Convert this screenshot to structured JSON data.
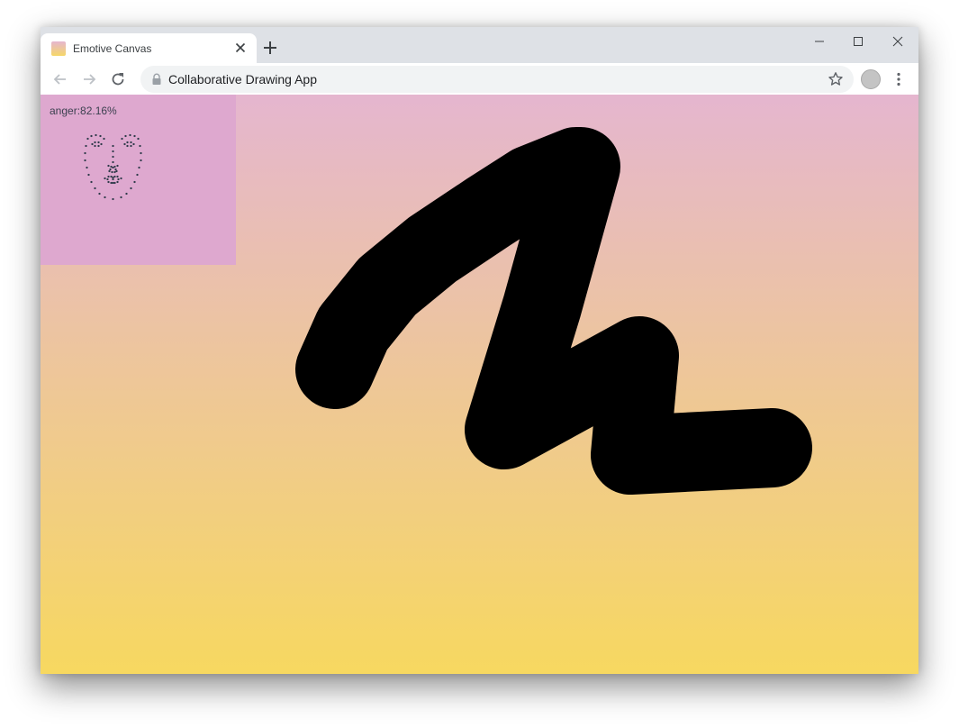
{
  "browser": {
    "tab": {
      "title": "Emotive Canvas",
      "favicon_colors": [
        "#e5b6cf",
        "#f5d768"
      ]
    },
    "address_bar": {
      "text": "Collaborative Drawing App"
    },
    "icons": [
      "back-icon",
      "forward-icon",
      "reload-icon",
      "lock-icon",
      "star-icon",
      "profile-avatar",
      "menu-icon",
      "close-icon",
      "plus-icon",
      "minimize-icon",
      "maximize-icon"
    ]
  },
  "app": {
    "background_gradient": {
      "top": "#e5b6cf",
      "bottom": "#f7d860"
    },
    "emotion": {
      "label": "anger:82.16%",
      "emotion": "anger",
      "confidence_percent": 82.16,
      "panel_color": "#dea8cf",
      "landmark_color": "#2f3a4a"
    },
    "stroke": {
      "color": "#000000"
    }
  }
}
